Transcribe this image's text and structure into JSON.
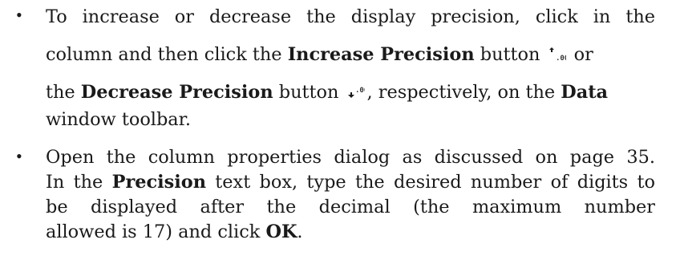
{
  "bullets": [
    {
      "symbol": "•",
      "p1": "To increase or decrease the display precision, click in the",
      "p2": "column and then click the ",
      "increase_label": "Increase Precision",
      "p3": " button ",
      "increase_icon_caption": ".00",
      "p4": " or",
      "p5": "the ",
      "decrease_label": "Decrease Precision",
      "p6": " button ",
      "decrease_icon_caption": ".00",
      "p7": ", respectively, on the ",
      "data_label": "Data",
      "p8": "window toolbar."
    },
    {
      "symbol": "•",
      "p1": "Open the column properties dialog as discussed on page 35.",
      "p2": "In the ",
      "precision_label": "Precision",
      "p3": " text box, type the desired number of digits to",
      "p4": "be displayed after the decimal (the maximum number",
      "p5": "allowed is 17) and click ",
      "ok_label": "OK",
      "p6": "."
    }
  ],
  "icons": {
    "increase": "increase-precision-icon",
    "decrease": "decrease-precision-icon",
    "icon_color": "#333333",
    "arrow_color": "#1a1a1a"
  }
}
